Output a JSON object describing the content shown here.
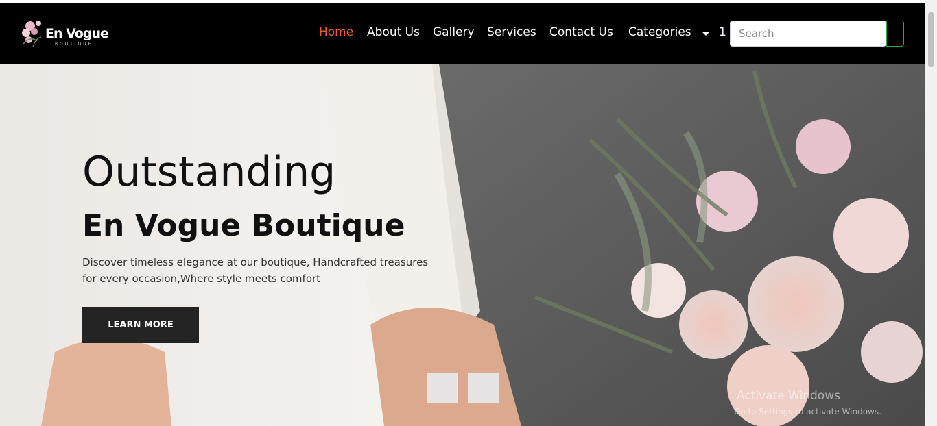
{
  "brand": {
    "name": "En Vogue",
    "sub": "BOUTIQUE"
  },
  "nav": {
    "home": "Home",
    "about": "About Us",
    "gallery": "Gallery",
    "services": "Services",
    "contact": "Contact Us",
    "categories": "Categories",
    "cart_count": "1"
  },
  "search": {
    "placeholder": "Search",
    "value": ""
  },
  "hero": {
    "title_line1": "Outstanding",
    "title_line2": "En Vogue Boutique",
    "desc_line1": "Discover timeless elegance at our boutique, Handcrafted treasures",
    "desc_line2": "for every occasion,Where style meets comfort",
    "button": "LEARN MORE"
  },
  "watermark": {
    "line1": "Activate Windows",
    "line2": "Go to Settings to activate Windows."
  },
  "colors": {
    "nav_bg": "#000000",
    "active_link": "#f05a30",
    "button_bg": "#242424",
    "search_button_border": "#28a745"
  },
  "icons": [
    "flower-logo-icon",
    "caret-down-icon"
  ]
}
